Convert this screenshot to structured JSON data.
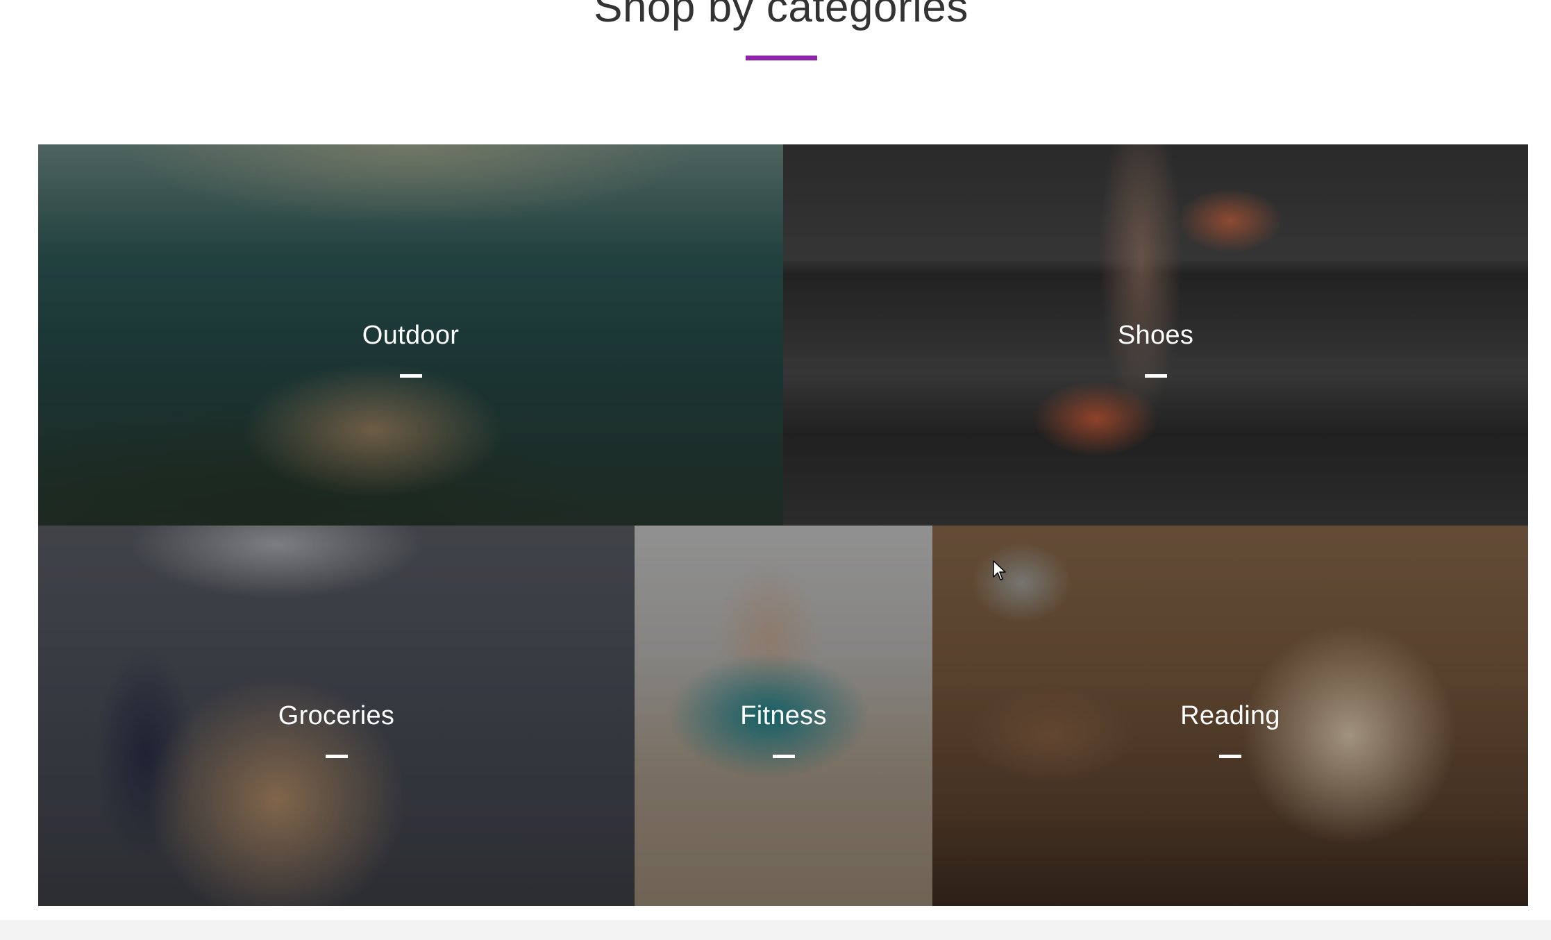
{
  "section": {
    "title": "Shop by categories",
    "accent_color": "#8e24aa"
  },
  "categories": [
    {
      "label": "Outdoor"
    },
    {
      "label": "Shoes"
    },
    {
      "label": "Groceries"
    },
    {
      "label": "Fitness"
    },
    {
      "label": "Reading"
    }
  ],
  "icons": {
    "cursor": "mouse-pointer-icon",
    "tile_dash": "dash-icon"
  }
}
